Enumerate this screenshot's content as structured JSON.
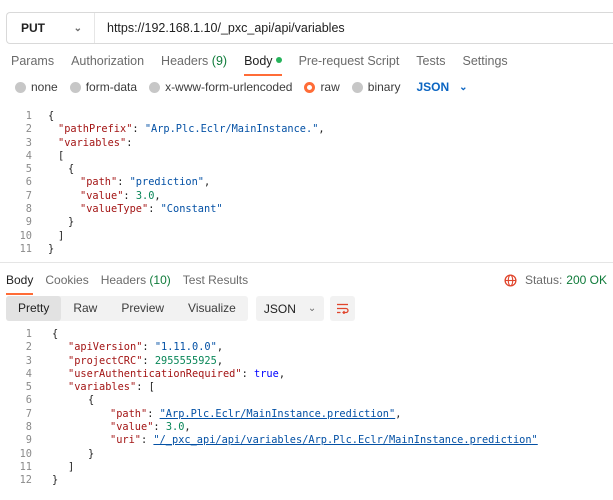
{
  "request": {
    "method": "PUT",
    "url": "https://192.168.1.10/_pxc_api/api/variables"
  },
  "request_tabs": [
    {
      "label": "Params",
      "count": ""
    },
    {
      "label": "Authorization",
      "count": ""
    },
    {
      "label": "Headers",
      "count": "(9)"
    },
    {
      "label": "Body",
      "count": ""
    },
    {
      "label": "Pre-request Script",
      "count": ""
    },
    {
      "label": "Tests",
      "count": ""
    },
    {
      "label": "Settings",
      "count": ""
    }
  ],
  "body_types": [
    "none",
    "form-data",
    "x-www-form-urlencoded",
    "raw",
    "binary"
  ],
  "body_format": "JSON",
  "request_body_lines": [
    {
      "n": "1",
      "text": "{"
    },
    {
      "n": "2",
      "key": "\"pathPrefix\"",
      "value": "\"Arp.Plc.Eclr/MainInstance.\"",
      "tail": ","
    },
    {
      "n": "3",
      "key": "\"variables\"",
      "tail": ":"
    },
    {
      "n": "4",
      "text": "["
    },
    {
      "n": "5",
      "text": "{"
    },
    {
      "n": "6",
      "key": "\"path\"",
      "value": "\"prediction\"",
      "tail": ","
    },
    {
      "n": "7",
      "key": "\"value\"",
      "value": "3.0",
      "tail": ","
    },
    {
      "n": "8",
      "key": "\"valueType\"",
      "value": "\"Constant\"",
      "tail": ""
    },
    {
      "n": "9",
      "text": "}"
    },
    {
      "n": "10",
      "text": "]"
    },
    {
      "n": "11",
      "text": "}"
    }
  ],
  "response_tabs": [
    {
      "label": "Body",
      "count": ""
    },
    {
      "label": "Cookies",
      "count": ""
    },
    {
      "label": "Headers",
      "count": "(10)"
    },
    {
      "label": "Test Results",
      "count": ""
    }
  ],
  "status": {
    "label": "Status:",
    "value": "200 OK"
  },
  "view_options": [
    "Pretty",
    "Raw",
    "Preview",
    "Visualize"
  ],
  "response_format": "JSON",
  "response_body_lines": [
    {
      "n": "1",
      "text": "{"
    },
    {
      "n": "2",
      "key": "\"apiVersion\"",
      "value": "\"1.11.0.0\"",
      "tail": ","
    },
    {
      "n": "3",
      "key": "\"projectCRC\"",
      "value": "2955555925",
      "tail": ","
    },
    {
      "n": "4",
      "key": "\"userAuthenticationRequired\"",
      "value": "true",
      "tail": ","
    },
    {
      "n": "5",
      "key": "\"variables\"",
      "value": "[",
      "tail": ""
    },
    {
      "n": "6",
      "text": "{"
    },
    {
      "n": "7",
      "key": "\"path\"",
      "value": "\"Arp.Plc.Eclr/MainInstance.prediction\"",
      "tail": ","
    },
    {
      "n": "8",
      "key": "\"value\"",
      "value": "3.0",
      "tail": ","
    },
    {
      "n": "9",
      "key": "\"uri\"",
      "value": "\"/_pxc_api/api/variables/Arp.Plc.Eclr/MainInstance.prediction\"",
      "tail": ""
    },
    {
      "n": "10",
      "text": "}"
    },
    {
      "n": "11",
      "text": "]"
    },
    {
      "n": "12",
      "text": "}"
    }
  ],
  "colors": {
    "accent": "#ff6c37",
    "success": "#0f7b3a",
    "link": "#0b65c2"
  },
  "icons": [
    "chevron-down-icon",
    "globe-icon",
    "wrap-lines-icon"
  ]
}
